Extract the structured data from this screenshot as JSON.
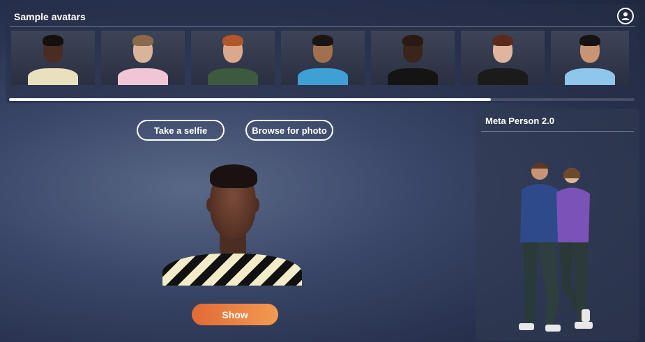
{
  "samples": {
    "title": "Sample avatars",
    "account_icon": "user-circle-icon",
    "avatars": [
      {
        "skin": "#4a2c20",
        "hair": "#151010",
        "shirt": "#e9e1bd"
      },
      {
        "skin": "#d9b39a",
        "hair": "#8a6a4a",
        "shirt": "#f0c6d6"
      },
      {
        "skin": "#dba88c",
        "hair": "#b0582c",
        "shirt": "#3e5a3e"
      },
      {
        "skin": "#a2704f",
        "hair": "#1a1412",
        "shirt": "#3fa0d6"
      },
      {
        "skin": "#3b2419",
        "hair": "#2a1a14",
        "shirt": "#141414"
      },
      {
        "skin": "#dfb59d",
        "hair": "#5a2a1c",
        "shirt": "#1b1b1b"
      },
      {
        "skin": "#c99474",
        "hair": "#151212",
        "shirt": "#8fc6ec"
      }
    ],
    "scroll_fraction": 0.77
  },
  "actions": {
    "selfie_label": "Take a selfie",
    "browse_label": "Browse for photo",
    "show_label": "Show"
  },
  "meta_panel": {
    "title": "Meta Person 2.0"
  },
  "colors": {
    "accent_start": "#e36a34",
    "accent_end": "#f29b52"
  }
}
